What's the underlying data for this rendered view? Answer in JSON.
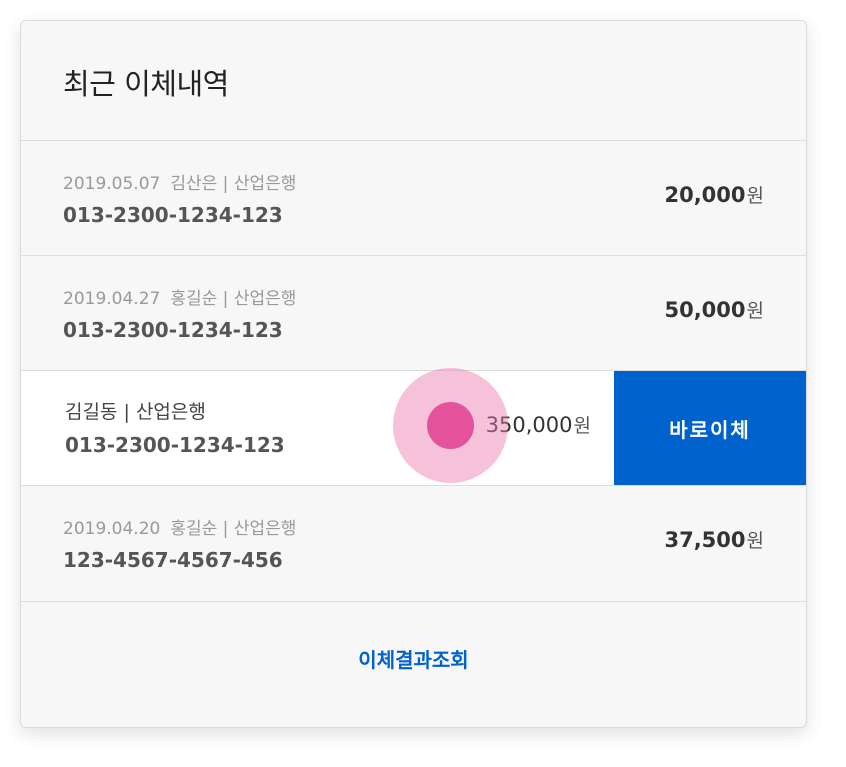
{
  "title": "최근 이체내역",
  "currency": "원",
  "transfers": [
    {
      "date": "2019.05.07",
      "name": "김산은",
      "bank": "산업은행",
      "account": "013-2300-1234-123",
      "amount": "20,000"
    },
    {
      "date": "2019.04.27",
      "name": "홍길순",
      "bank": "산업은행",
      "account": "013-2300-1234-123",
      "amount": "50,000"
    },
    {
      "name": "김길동",
      "bank": "산업은행",
      "account": "013-2300-1234-123",
      "amount": "350,000",
      "action": "바로이체"
    },
    {
      "date": "2019.04.20",
      "name": "홍길순",
      "bank": "산업은행",
      "account": "123-4567-4567-456",
      "amount": "37,500"
    }
  ],
  "separator": "|",
  "footer_link": "이체결과조회",
  "colors": {
    "accent": "#0062cc",
    "touch": "#e24c97"
  }
}
